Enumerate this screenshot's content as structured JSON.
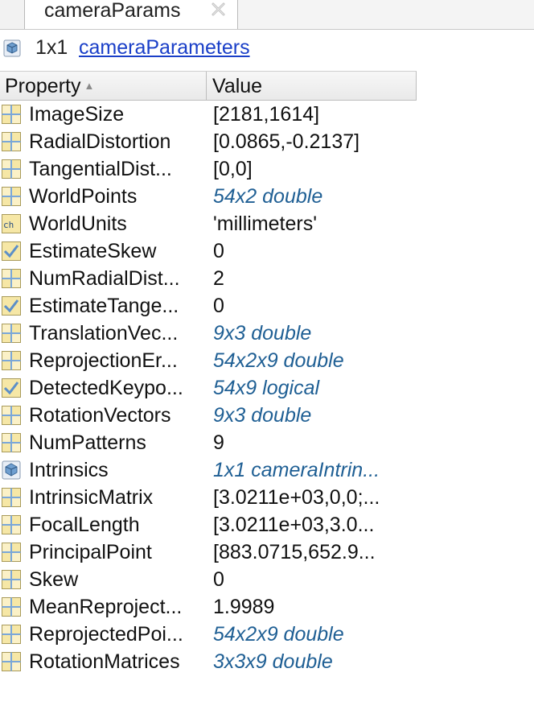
{
  "tab": {
    "title": "cameraParams"
  },
  "header": {
    "size": "1x1",
    "class_link": "cameraParameters"
  },
  "columns": {
    "property": "Property",
    "sort_glyph": "▲",
    "value": "Value"
  },
  "rows": [
    {
      "name": "ImageSize",
      "value": "[2181,1614]",
      "icon": "matrix-icon",
      "link": false
    },
    {
      "name": "RadialDistortion",
      "value": "[0.0865,-0.2137]",
      "icon": "matrix-icon",
      "link": false
    },
    {
      "name": "TangentialDist...",
      "value": "[0,0]",
      "icon": "matrix-icon",
      "link": false
    },
    {
      "name": "WorldPoints",
      "value": "54x2 double",
      "icon": "matrix-icon",
      "link": true
    },
    {
      "name": "WorldUnits",
      "value": "'millimeters'",
      "icon": "char-icon",
      "link": false
    },
    {
      "name": "EstimateSkew",
      "value": "0",
      "icon": "logical-icon",
      "link": false
    },
    {
      "name": "NumRadialDist...",
      "value": "2",
      "icon": "matrix-icon",
      "link": false
    },
    {
      "name": "EstimateTange...",
      "value": "0",
      "icon": "logical-icon",
      "link": false
    },
    {
      "name": "TranslationVec...",
      "value": "9x3 double",
      "icon": "matrix-icon",
      "link": true
    },
    {
      "name": "ReprojectionEr...",
      "value": "54x2x9 double",
      "icon": "matrix-icon",
      "link": true
    },
    {
      "name": "DetectedKeypo...",
      "value": "54x9 logical",
      "icon": "logical-icon",
      "link": true
    },
    {
      "name": "RotationVectors",
      "value": "9x3 double",
      "icon": "matrix-icon",
      "link": true
    },
    {
      "name": "NumPatterns",
      "value": "9",
      "icon": "matrix-icon",
      "link": false
    },
    {
      "name": "Intrinsics",
      "value": "1x1 cameraIntrin...",
      "icon": "object-icon",
      "link": true
    },
    {
      "name": "IntrinsicMatrix",
      "value": "[3.0211e+03,0,0;...",
      "icon": "matrix-icon",
      "link": false
    },
    {
      "name": "FocalLength",
      "value": "[3.0211e+03,3.0...",
      "icon": "matrix-icon",
      "link": false
    },
    {
      "name": "PrincipalPoint",
      "value": "[883.0715,652.9...",
      "icon": "matrix-icon",
      "link": false
    },
    {
      "name": "Skew",
      "value": "0",
      "icon": "matrix-icon",
      "link": false
    },
    {
      "name": "MeanReproject...",
      "value": "1.9989",
      "icon": "matrix-icon",
      "link": false
    },
    {
      "name": "ReprojectedPoi...",
      "value": "54x2x9 double",
      "icon": "matrix-icon",
      "link": true
    },
    {
      "name": "RotationMatrices",
      "value": "3x3x9 double",
      "icon": "matrix-icon",
      "link": true
    }
  ]
}
